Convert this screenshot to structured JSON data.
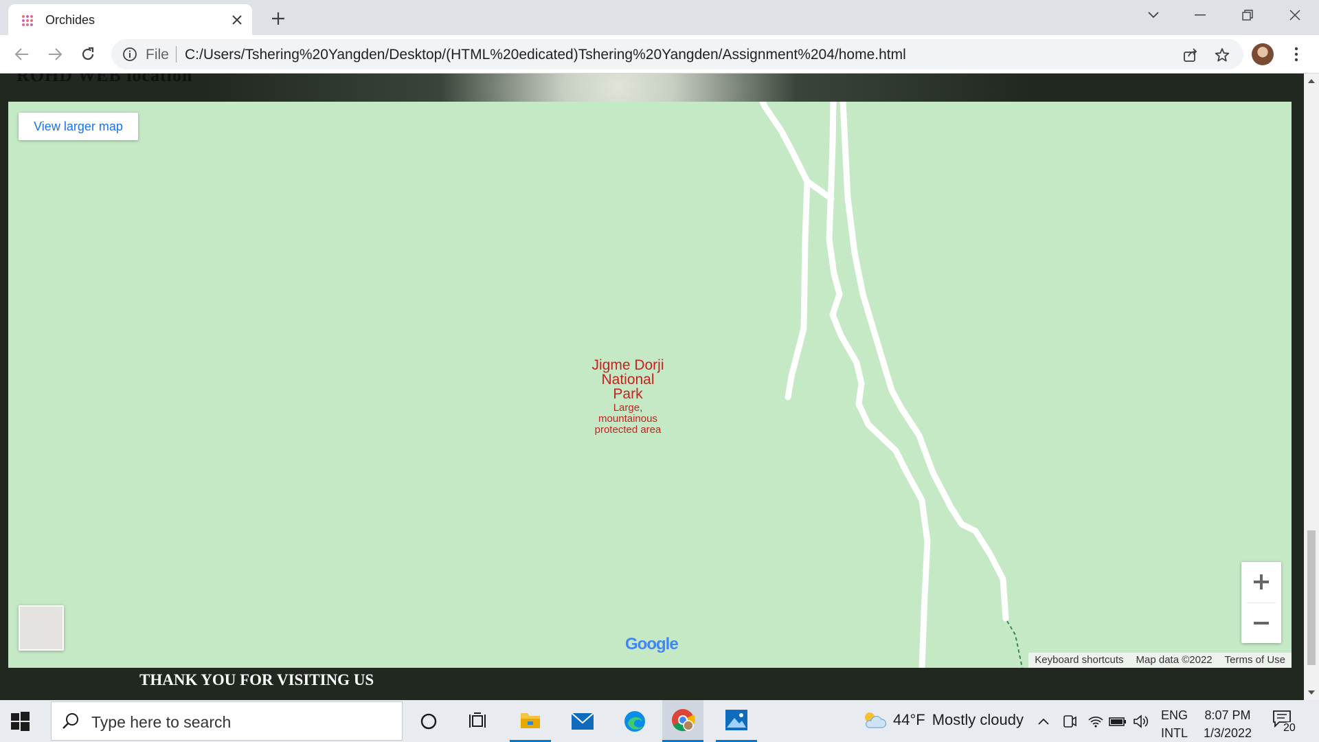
{
  "browser": {
    "tab_title": "Orchides",
    "url_scheme": "File",
    "url": "C:/Users/Tshering%20Yangden/Desktop/(HTML%20edicated)Tshering%20Yangden/Assignment%204/home.html"
  },
  "page": {
    "heading": "ROHD WEB location",
    "footer_text": "THANK YOU FOR VISITING US"
  },
  "map": {
    "view_larger_label": "View larger map",
    "park_name_line1": "Jigme Dorji",
    "park_name_line2": "National Park",
    "park_desc_line1": "Large,",
    "park_desc_line2": "mountainous",
    "park_desc_line3": "protected area",
    "logo_text": "Google",
    "attribution": {
      "shortcuts": "Keyboard shortcuts",
      "map_data": "Map data ©2022",
      "terms": "Terms of Use"
    },
    "colors": {
      "land": "#c5e8c5",
      "road": "#ffffff",
      "label": "#c5221f"
    }
  },
  "taskbar": {
    "search_placeholder": "Type here to search",
    "weather_temp": "44°F",
    "weather_desc": "Mostly cloudy",
    "lang_line1": "ENG",
    "lang_line2": "INTL",
    "time": "8:07 PM",
    "date": "1/3/2022",
    "notification_count": "20"
  }
}
